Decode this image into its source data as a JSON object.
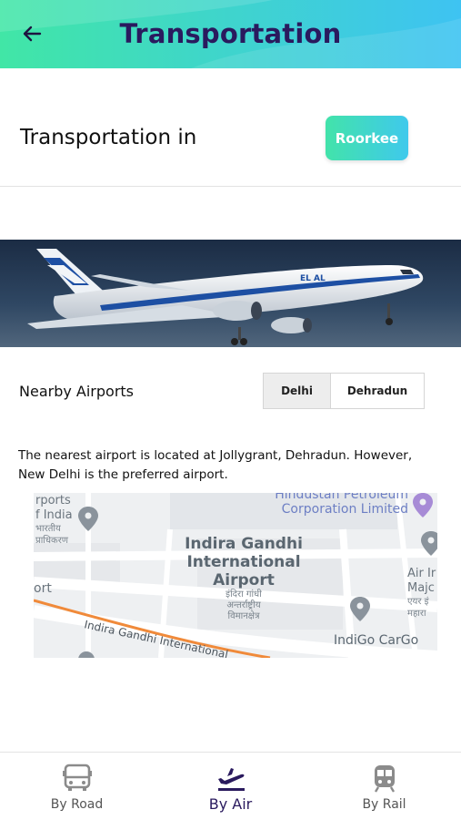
{
  "header": {
    "title": "Transportation",
    "back_icon": "arrow-left-icon"
  },
  "location": {
    "label": "Transportation in",
    "city": "Roorkee"
  },
  "hero": {
    "airline_text": "EL AL"
  },
  "airports": {
    "label": "Nearby Airports",
    "tabs": [
      {
        "label": "Delhi",
        "selected": true
      },
      {
        "label": "Dehradun",
        "selected": false
      }
    ],
    "description": "The nearest airport is located at Jollygrant, Dehradun. However, New Delhi is the preferred airport."
  },
  "map": {
    "labels": {
      "airport_name_1": "Indira Gandhi",
      "airport_name_2": "International",
      "airport_name_3": "Airport",
      "airport_hindi_1": "इंदिरा गांधी",
      "airport_hindi_2": "अन्तर्राष्ट्रीय",
      "airport_hindi_3": "विमानक्षेत्र",
      "hpcl_1": "Hindustan Petroleum",
      "hpcl_2": "Corporation Limited",
      "indigo": "IndiGo CarGo",
      "airports_india_1": "rports",
      "airports_india_2": "f India",
      "airports_india_3": "भारतीय",
      "airports_india_4": "प्राधिकरण",
      "ort": "ort",
      "road": "Indira Gandhi International",
      "air_1": "Air Ir",
      "air_2": "Majc",
      "air_3": "एयर इं",
      "air_4": "महारा"
    }
  },
  "bottom_nav": {
    "items": [
      {
        "label": "By Road",
        "icon": "bus-icon",
        "active": false
      },
      {
        "label": "By Air",
        "icon": "plane-departure-icon",
        "active": true
      },
      {
        "label": "By Rail",
        "icon": "train-icon",
        "active": false
      }
    ]
  },
  "colors": {
    "header_gradient_start": "#41e6a6",
    "header_gradient_end": "#3ec3f2",
    "title_color": "#2a1a5e",
    "nav_active": "#2a1a5e",
    "nav_inactive": "#555555"
  }
}
